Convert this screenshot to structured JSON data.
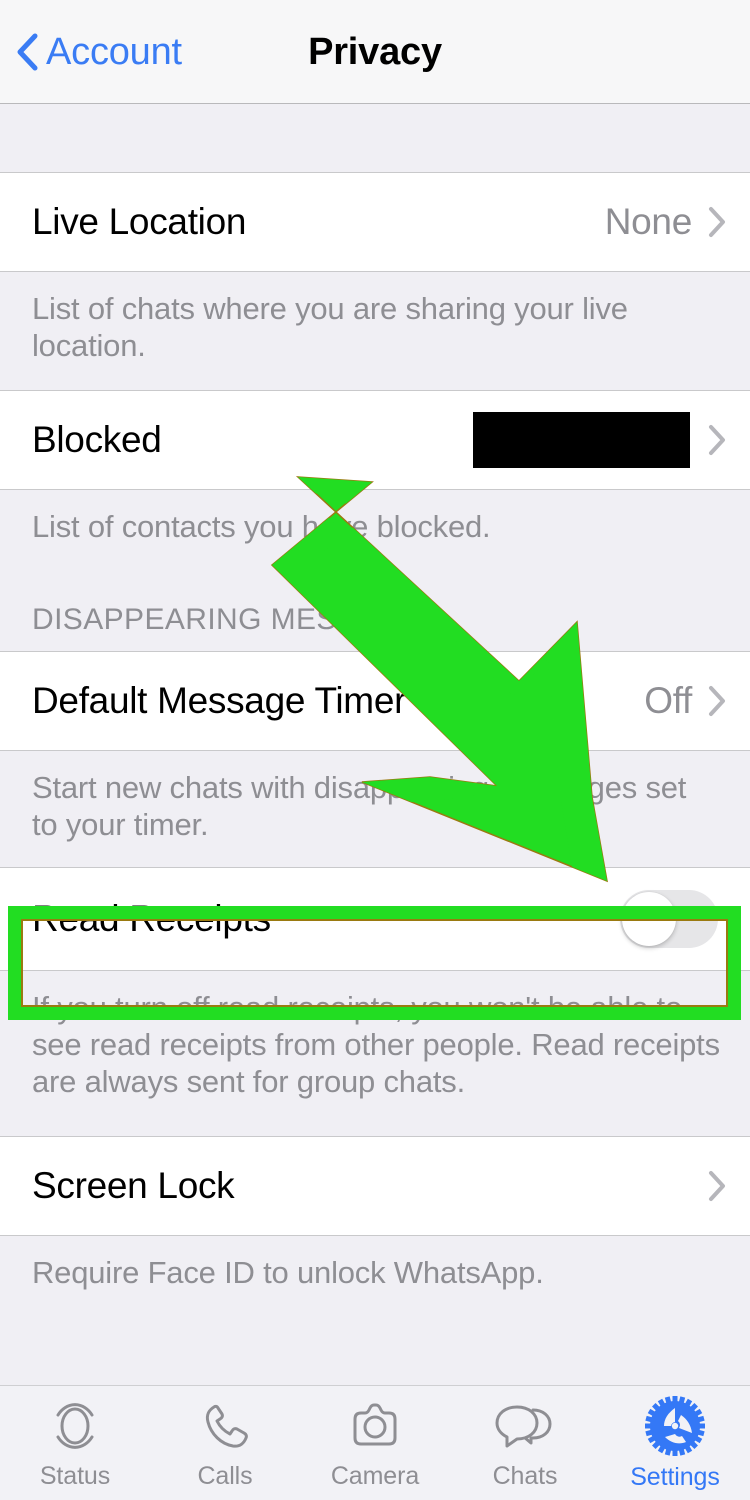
{
  "navbar": {
    "back_label": "Account",
    "back_icon": "chevron-left-icon",
    "title": "Privacy"
  },
  "rows": {
    "live_location": {
      "title": "Live Location",
      "value": "None",
      "chevron_icon": "chevron-right-icon",
      "footnote": "List of chats where you are sharing your live location."
    },
    "blocked": {
      "title": "Blocked",
      "value": "",
      "value_redacted": true,
      "chevron_icon": "chevron-right-icon",
      "footnote": "List of contacts you have blocked."
    },
    "disappearing_section": {
      "header": "DISAPPEARING MESSAGES"
    },
    "default_message_timer": {
      "title": "Default Message Timer",
      "value": "Off",
      "chevron_icon": "chevron-right-icon",
      "footnote": "Start new chats with disappearing messages set to your timer."
    },
    "read_receipts": {
      "title": "Read Receipts",
      "toggle_state": "off",
      "footnote": "If you turn off read receipts, you won't be able to see read receipts from other people. Read receipts are always sent for group chats."
    },
    "screen_lock": {
      "title": "Screen Lock",
      "chevron_icon": "chevron-right-icon",
      "footnote": "Require Face ID to unlock WhatsApp."
    }
  },
  "annotations": {
    "highlight_color": "#22dd22",
    "arrow_color": "#22dd22",
    "arrow_outline_color": "#9a7a10",
    "arrow_target": "read-receipts-row"
  },
  "tabbar": {
    "items": [
      {
        "label": "Status",
        "icon": "status-rings-icon",
        "active": false
      },
      {
        "label": "Calls",
        "icon": "phone-icon",
        "active": false
      },
      {
        "label": "Camera",
        "icon": "camera-icon",
        "active": false
      },
      {
        "label": "Chats",
        "icon": "chat-bubbles-icon",
        "active": false
      },
      {
        "label": "Settings",
        "icon": "gear-icon",
        "active": true
      }
    ]
  },
  "colors": {
    "accent_blue": "#3478f6",
    "value_grey": "#8e8e93",
    "page_bg": "#f0eff4",
    "row_bg": "#ffffff"
  }
}
